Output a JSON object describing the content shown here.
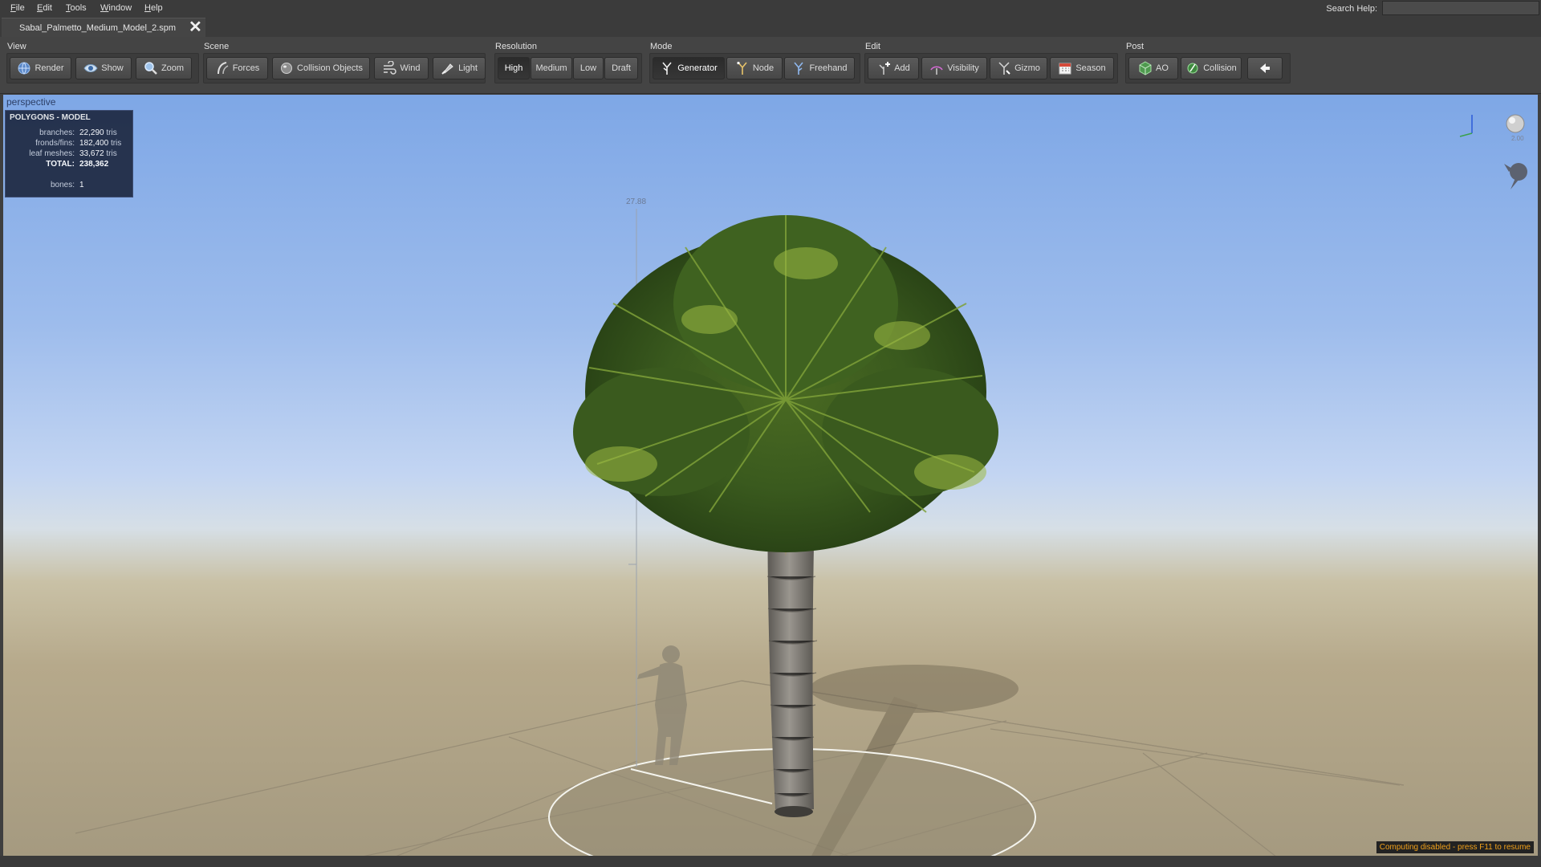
{
  "menu": [
    "File",
    "Edit",
    "Tools",
    "Window",
    "Help"
  ],
  "search": {
    "label": "Search Help:",
    "value": ""
  },
  "tab": {
    "title": "Sabal_Palmetto_Medium_Model_2.spm",
    "close": "✕"
  },
  "toolbar": {
    "view": {
      "label": "View",
      "buttons": [
        "Render",
        "Show",
        "Zoom"
      ]
    },
    "scene": {
      "label": "Scene",
      "buttons": [
        "Forces",
        "Collision Objects",
        "Wind",
        "Light"
      ]
    },
    "resolution": {
      "label": "Resolution",
      "buttons": [
        "High",
        "Medium",
        "Low",
        "Draft"
      ],
      "selected": "High"
    },
    "mode": {
      "label": "Mode",
      "buttons": [
        "Generator",
        "Node",
        "Freehand"
      ],
      "selected": "Generator"
    },
    "edit": {
      "label": "Edit",
      "buttons": [
        "Add",
        "Visibility",
        "Gizmo",
        "Season"
      ]
    },
    "post": {
      "label": "Post",
      "buttons": [
        "AO",
        "Collision"
      ]
    }
  },
  "viewport": {
    "camera": "perspective",
    "height_marker": "27.88",
    "scale_value": "2.00",
    "stats": {
      "title": "POLYGONS - MODEL",
      "rows": [
        {
          "label": "branches:",
          "value": "22,290",
          "unit": "tris"
        },
        {
          "label": "fronds/fins:",
          "value": "182,400",
          "unit": "tris"
        },
        {
          "label": "leaf meshes:",
          "value": "33,672",
          "unit": "tris"
        },
        {
          "label": "TOTAL:",
          "value": "238,362",
          "unit": ""
        },
        {
          "label": "bones:",
          "value": "1",
          "unit": ""
        }
      ]
    },
    "status": "Computing disabled - press F11 to resume"
  },
  "colors": {
    "sky_top": "#7ea7e6",
    "horizon": "#d6dfe6",
    "ground": "#a59a80",
    "status_text": "#f2a11a",
    "stats_bg": "#1f2a43"
  }
}
